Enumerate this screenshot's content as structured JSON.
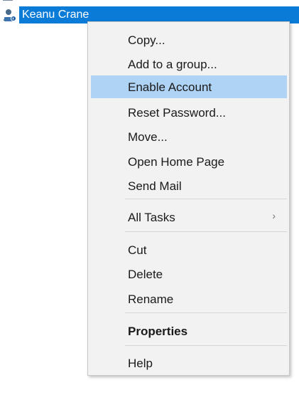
{
  "tree": {
    "selected_item": {
      "label": "Keanu Crane",
      "icon": "user-icon"
    },
    "partial_item_icon": "folder-icon"
  },
  "context_menu": {
    "items": [
      {
        "label": "Copy..."
      },
      {
        "label": "Add to a group..."
      },
      {
        "label": "Enable Account",
        "highlighted": true
      },
      {
        "label": "Reset Password..."
      },
      {
        "label": "Move..."
      },
      {
        "label": "Open Home Page"
      },
      {
        "label": "Send Mail"
      },
      {
        "label": "All Tasks",
        "has_submenu": true,
        "submenu_icon": "chevron-right-icon"
      },
      {
        "label": "Cut"
      },
      {
        "label": "Delete"
      },
      {
        "label": "Rename"
      },
      {
        "label": "Properties",
        "bold": true
      },
      {
        "label": "Help"
      }
    ]
  },
  "colors": {
    "selection": "#0a7bd7",
    "menu_background": "#f2f2f2",
    "menu_highlight": "#aed3f4"
  }
}
